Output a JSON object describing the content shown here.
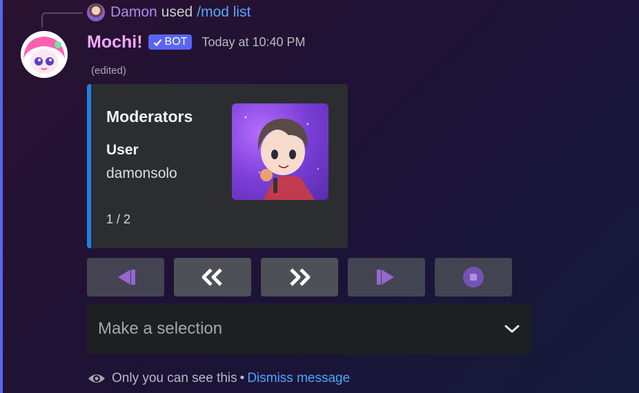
{
  "reply": {
    "user": "Damon",
    "used": "used",
    "command": "/mod list"
  },
  "message": {
    "author": "Mochi!",
    "bot_tag": "BOT",
    "timestamp": "Today at 10:40 PM",
    "edited": "(edited)"
  },
  "embed": {
    "title": "Moderators",
    "field_name": "User",
    "field_value": "damonsolo",
    "footer": "1 / 2",
    "accent_color": "#1e7fe6"
  },
  "buttons": [
    {
      "name": "first-page-button",
      "icon": "skip-start-icon"
    },
    {
      "name": "previous-page-button",
      "icon": "double-chevron-left-icon"
    },
    {
      "name": "next-page-button",
      "icon": "double-chevron-right-icon"
    },
    {
      "name": "last-page-button",
      "icon": "skip-end-icon"
    },
    {
      "name": "stop-button",
      "icon": "stop-icon"
    }
  ],
  "select": {
    "placeholder": "Make a selection"
  },
  "ephemeral": {
    "notice": "Only you can see this",
    "separator": "•",
    "dismiss": "Dismiss message"
  },
  "colors": {
    "blurple": "#5865f2",
    "link": "#4aa8ff",
    "button_bg": "#4e5058",
    "icon_purple": "#b47cf5"
  }
}
